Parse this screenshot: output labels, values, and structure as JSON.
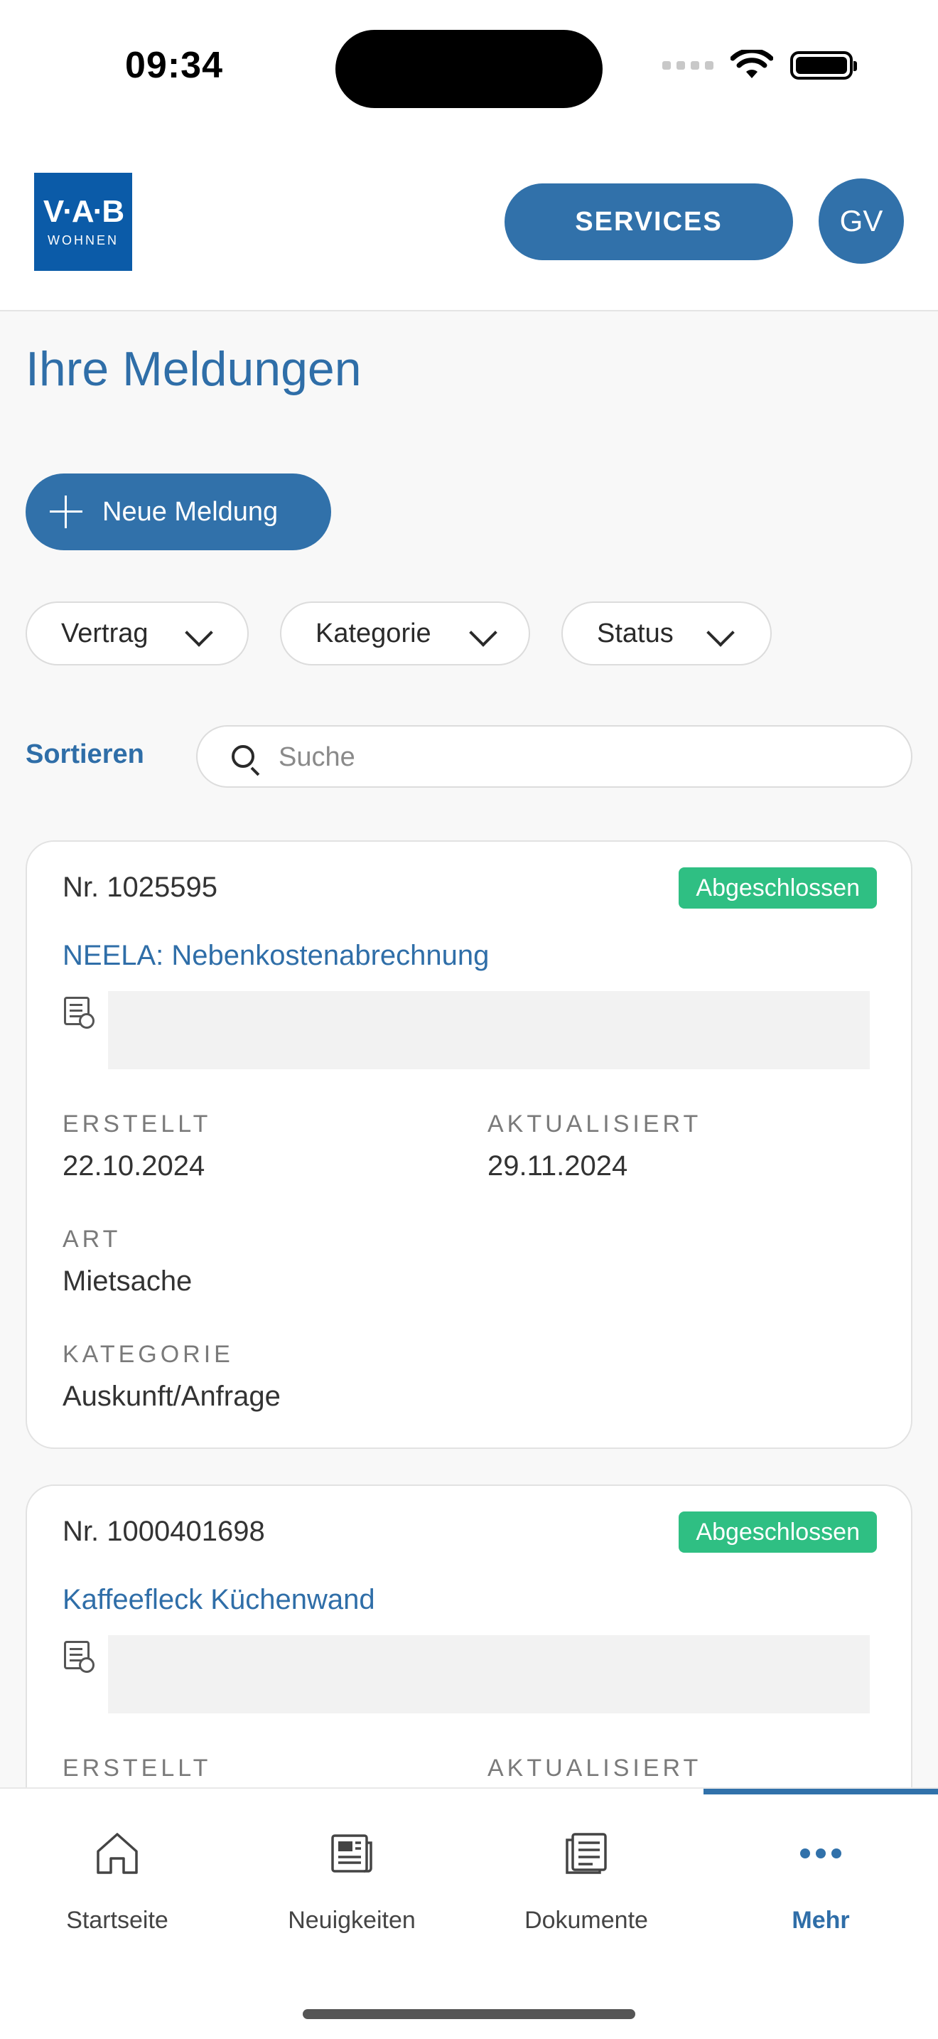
{
  "status_bar": {
    "time": "09:34"
  },
  "header": {
    "logo_main": "V·A·B",
    "logo_sub": "WOHNEN",
    "services_label": "SERVICES",
    "avatar_initials": "GV"
  },
  "page": {
    "title": "Ihre Meldungen",
    "new_button_label": "Neue Meldung"
  },
  "filters": [
    {
      "label": "Vertrag"
    },
    {
      "label": "Kategorie"
    },
    {
      "label": "Status"
    }
  ],
  "sort_label": "Sortieren",
  "search": {
    "placeholder": "Suche",
    "value": ""
  },
  "cards": [
    {
      "number": "Nr. 1025595",
      "status": "Abgeschlossen",
      "title": "NEELA: Nebenkostenabrechnung",
      "created_label": "ERSTELLT",
      "created_value": "22.10.2024",
      "updated_label": "AKTUALISIERT",
      "updated_value": "29.11.2024",
      "type_label": "ART",
      "type_value": "Mietsache",
      "category_label": "KATEGORIE",
      "category_value": "Auskunft/Anfrage"
    },
    {
      "number": "Nr. 1000401698",
      "status": "Abgeschlossen",
      "title": "Kaffeefleck Küchenwand",
      "created_label": "ERSTELLT",
      "updated_label": "AKTUALISIERT"
    }
  ],
  "bottom_nav": {
    "items": [
      {
        "label": "Startseite",
        "icon": "home-icon"
      },
      {
        "label": "Neuigkeiten",
        "icon": "news-icon"
      },
      {
        "label": "Dokumente",
        "icon": "documents-icon"
      },
      {
        "label": "Mehr",
        "icon": "more-icon",
        "active": true
      }
    ]
  },
  "colors": {
    "primary": "#3171aa",
    "title": "#2f6ea8",
    "success": "#2fbf83",
    "logo": "#0b5ba8"
  }
}
